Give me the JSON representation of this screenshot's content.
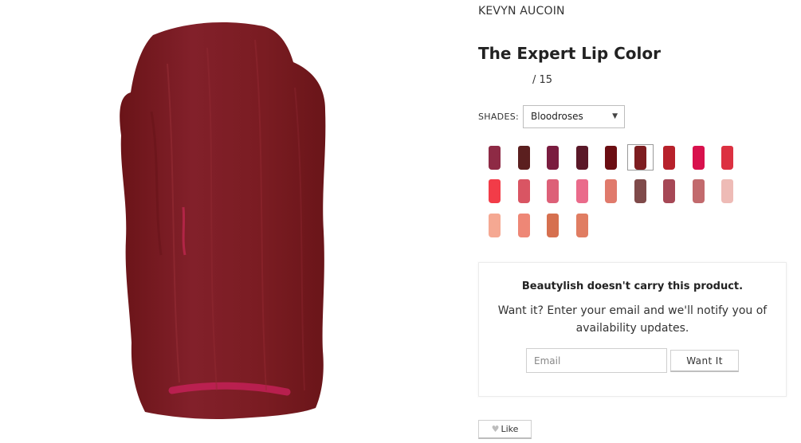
{
  "product": {
    "brand": "KEVYN AUCOIN",
    "title": "The Expert Lip Color",
    "rating_text": "/ 15"
  },
  "shades": {
    "label": "SHADES:",
    "selected": "Bloodroses",
    "selected_index": 5,
    "swatches": [
      {
        "color": "#8e2a45"
      },
      {
        "color": "#5b1f1f"
      },
      {
        "color": "#7a1c3f"
      },
      {
        "color": "#5a1828"
      },
      {
        "color": "#6b0d12"
      },
      {
        "color": "#7d1d20"
      },
      {
        "color": "#b7212b"
      },
      {
        "color": "#d8114d"
      },
      {
        "color": "#dc3141"
      },
      {
        "color": "#f23c48"
      },
      {
        "color": "#d95563"
      },
      {
        "color": "#dd6078"
      },
      {
        "color": "#ea6b8b"
      },
      {
        "color": "#e07a6c"
      },
      {
        "color": "#7f4a4a"
      },
      {
        "color": "#a64856"
      },
      {
        "color": "#c26a6d"
      },
      {
        "color": "#eebbb6"
      },
      {
        "color": "#f5a892"
      },
      {
        "color": "#ee8776"
      },
      {
        "color": "#d6704f"
      },
      {
        "color": "#e07d62"
      }
    ]
  },
  "main_image": {
    "color": "#7d1d20",
    "icon": "lipstick-swatch-image"
  },
  "notify": {
    "title": "Beautylish doesn't carry this product.",
    "text": "Want it? Enter your email and we'll notify you of availability updates.",
    "email_placeholder": "Email",
    "button_label": "Want It"
  },
  "like": {
    "label": "Like",
    "icon": "heart-icon"
  }
}
